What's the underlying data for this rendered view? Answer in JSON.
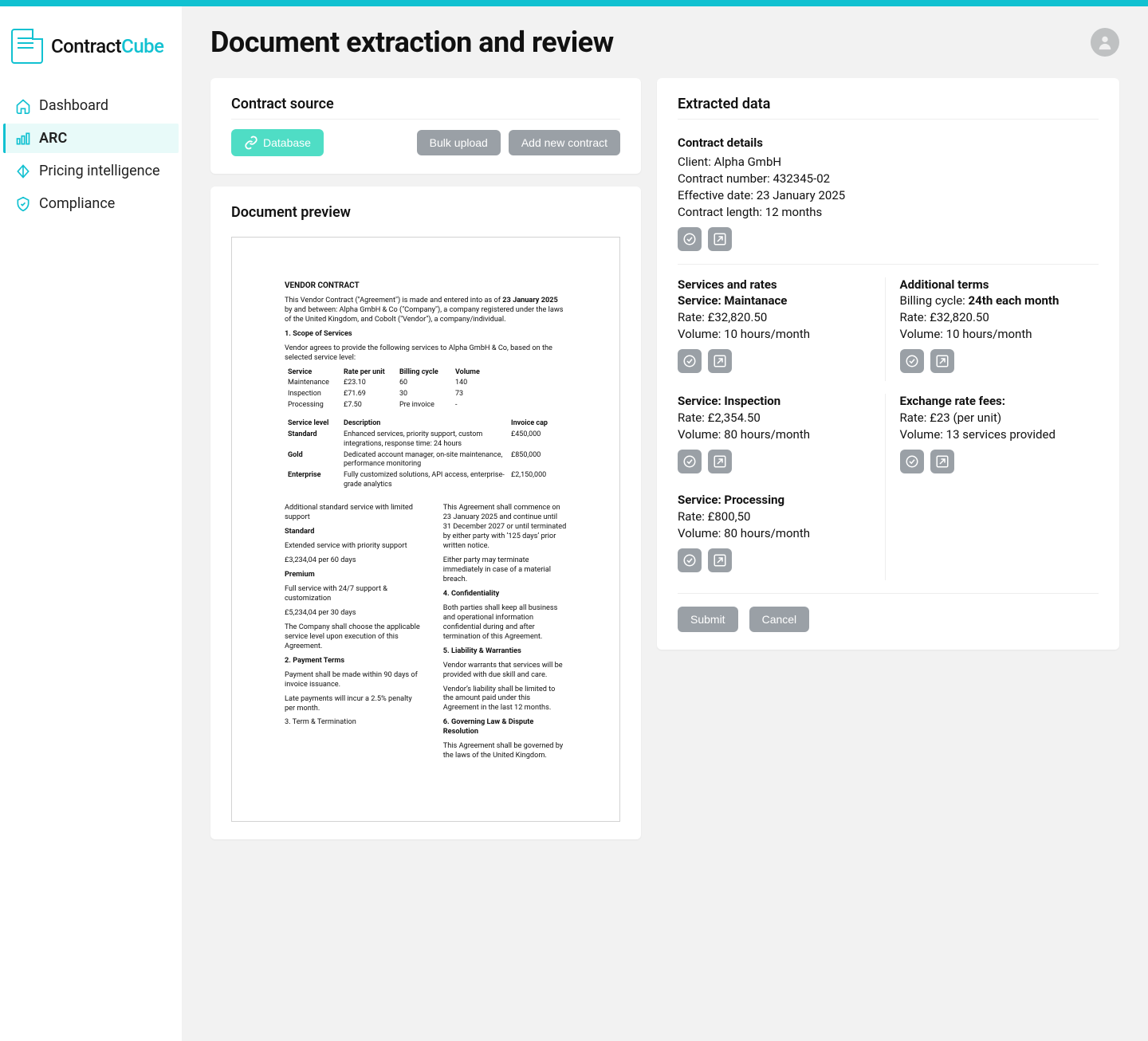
{
  "brand": {
    "name_a": "Contract",
    "name_b": "Cube"
  },
  "page_title": "Document extraction and review",
  "nav": [
    {
      "label": "Dashboard",
      "active": false
    },
    {
      "label": "ARC",
      "active": true
    },
    {
      "label": "Pricing intelligence",
      "active": false
    },
    {
      "label": "Compliance",
      "active": false
    }
  ],
  "contract_source": {
    "heading": "Contract source",
    "db_label": "Database",
    "bulk_label": "Bulk upload",
    "add_label": "Add new contract"
  },
  "document_preview": {
    "heading": "Document preview",
    "title": "VENDOR CONTRACT",
    "intro_a": "This Vendor Contract (\"Agreement\") is made and entered into as of ",
    "intro_date": "23 January 2025",
    "intro_b": " by and between: Alpha GmbH & Co (\"Company\"), a company registered under the laws of the United Kingdom, and Cobolt (\"Vendor\"), a company/individual.",
    "s1_title": "1. Scope of Services",
    "s1_body": "Vendor agrees to provide the following services to Alpha GmbH & Co, based on the selected service level:",
    "svc_headers": [
      "Service",
      "Rate per unit",
      "Billing cycle",
      "Volume"
    ],
    "svc_rows": [
      [
        "Maintenance",
        "£23.10",
        "60",
        "140"
      ],
      [
        "Inspection",
        "£71.69",
        "30",
        "73"
      ],
      [
        "Processing",
        "£7.50",
        "Pre invoice",
        "-"
      ]
    ],
    "lvl_headers": [
      "Service level",
      "Description",
      "Invoice cap"
    ],
    "lvl_rows": [
      [
        "Standard",
        "Enhanced services, priority support, custom integrations, response time: 24 hours",
        "£450,000"
      ],
      [
        "Gold",
        "Dedicated account manager, on-site maintenance, performance monitoring",
        "£850,000"
      ],
      [
        "Enterprise",
        "Fully customized solutions, API access, enterprise-grade analytics",
        "£2,150,000"
      ]
    ],
    "addl_title": "Additional standard service with limited support",
    "std_title": "Standard",
    "std_body1": "Extended service with priority support",
    "std_body2": "£3,234,04 per 60 days",
    "prem_title": "Premium",
    "prem_body1": "Full service with 24/7 support & customization",
    "prem_body2": "£5,234,04 per 30 days",
    "choose_body": "The Company shall choose the applicable service level upon execution of this Agreement.",
    "s2_title": "2. Payment Terms",
    "s2_body1": "Payment shall be made within 90 days of invoice issuance.",
    "s2_body2": "Late payments will incur a 2.5% penalty per month.",
    "s3_title": "3. Term & Termination",
    "s3_body1": "This Agreement shall commence on 23 January 2025 and continue until 31 December 2027 or until terminated by either party with ‘125 days’ prior written notice.",
    "s3_body2": "Either party may terminate immediately in case of a material breach.",
    "s4_title": "4. Confidentiality",
    "s4_body": "Both parties shall keep all business and operational information confidential during and after termination of this Agreement.",
    "s5_title": "5. Liability & Warranties",
    "s5_body1": "Vendor warrants that services will be provided with due skill and care.",
    "s5_body2": "Vendor’s liability shall be limited to the amount paid under this Agreement in the last 12 months.",
    "s6_title": "6. Governing Law & Dispute Resolution",
    "s6_body": "This Agreement shall be governed by the laws of the United Kingdom."
  },
  "extracted": {
    "heading": "Extracted data",
    "details_title": "Contract details",
    "client_label": "Client:",
    "client_value": "Alpha GmbH",
    "contract_num_label": "Contract number:",
    "contract_num_value": "432345-02",
    "eff_label": "Effective date:",
    "eff_value": "23 January 2025",
    "len_label": "Contract length:",
    "len_value": "12 months",
    "services_title": "Services and rates",
    "svc1_label": "Service:",
    "svc1_value": "Maintanace",
    "rate_label": "Rate:",
    "svc1_rate": "£32,820.50",
    "vol_label": "Volume:",
    "svc1_vol": "10 hours/month",
    "addl_title": "Additional terms",
    "addl_cycle_label": "Billing cycle: ",
    "addl_cycle_value": "24th each month",
    "addl_rate": "£32,820.50",
    "addl_vol": "10 hours/month",
    "svc2_label": "Service:  ",
    "svc2_value": "Inspection",
    "svc2_rate": "£2,354.50",
    "svc2_vol": "80 hours/month",
    "exch_title": "Exchange rate fees:",
    "exch_rate": "£23 (per unit)",
    "exch_vol": "13 services provided",
    "svc3_value": "Processing",
    "svc3_rate": "£800,50",
    "svc3_vol": "80 hours/month",
    "submit": "Submit",
    "cancel": "Cancel"
  }
}
